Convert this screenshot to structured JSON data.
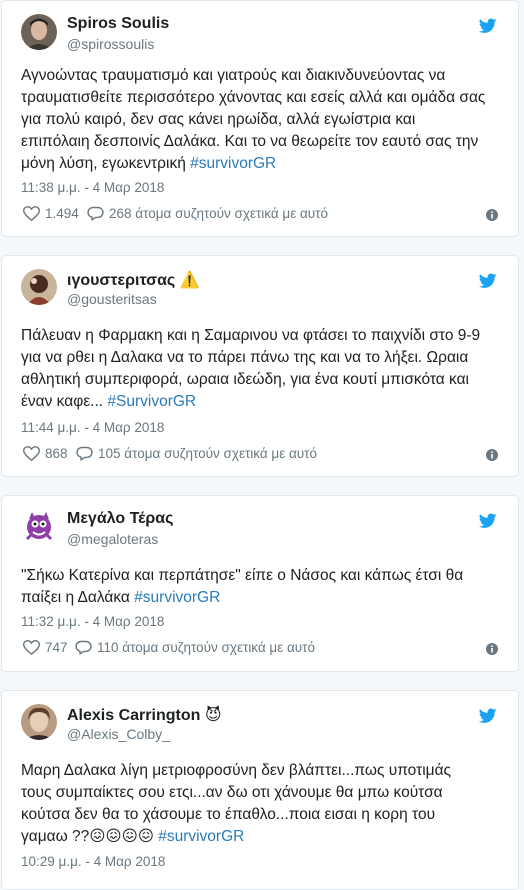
{
  "tweets": [
    {
      "name": "Spiros Soulis",
      "name_emoji": "",
      "handle": "@spirossoulis",
      "text": "Αγνοώντας τραυματισμό και γιατρούς και διακινδυνεύοντας να\nτραυματισθείτε περισσότερο χάνοντας και εσείς αλλά και ομάδα σας\nγια πολύ καιρό, δεν σας κάνει ηρωίδα, αλλά εγωίστρια και\nεπιπόλαιη δεσποινίς Δαλάκα. Και το να θεωρείτε τον εαυτό σας την\nμόνη λύση, εγωκεντρική ",
      "hashtag": "#survivorGR",
      "time": "11:38 μ.μ. - 4 Μαρ 2018",
      "likes": "1.494",
      "replies": "268 άτομα συζητούν σχετικά με αυτό"
    },
    {
      "name": "ιγουστεριτσας",
      "name_emoji": "⚠️",
      "handle": "@gousteritsas",
      "text": "Πάλευαν η Φαρμακη και η Σαμαρινου να φτάσει το παιχνίδι στο 9-9\nγια να ρθει η Δαλακα να το πάρει πάνω της και να το λήξει. Ωραια\nαθλητική συμπεριφορά, ωραια ιδεώδη, για ένα κουτί μπισκότα και\nέναν καφε... ",
      "hashtag": "#SurvivorGR",
      "time": "11:44 μ.μ. - 4 Μαρ 2018",
      "likes": "868",
      "replies": "105 άτομα συζητούν σχετικά με αυτό"
    },
    {
      "name": "Μεγάλο Τέρας",
      "name_emoji": "",
      "handle": "@megaloteras",
      "text": "\"Σήκω Κατερίνα και περπάτησε\" είπε ο Νάσος και κάπως έτσι θα\nπαίξει η Δαλάκα ",
      "hashtag": "#survivorGR",
      "time": "11:32 μ.μ. - 4 Μαρ 2018",
      "likes": "747",
      "replies": "110 άτομα συζητούν σχετικά με αυτό"
    },
    {
      "name": "Alexis Carrington",
      "name_emoji": "😈",
      "handle": "@Alexis_Colby_",
      "text": "Μαρη Δαλακα λίγη μετριοφροσύνη δεν βλάπτει...πως υποτιμάς\nτους συμπαίκτες σου ετςι...αν δω οτι χάνουμε θα μπω κούτσα\nκούτσα δεν θα το χάσουμε το έπαθλο...ποια εισαι η κορη του\nγαμαω ??😖😖😖😖 ",
      "hashtag": "#survivorGR",
      "time": "10:29 μ.μ. - 4 Μαρ 2018",
      "likes": "",
      "replies": ""
    }
  ],
  "colors": {
    "link": "#2b7bb9",
    "twitter_blue": "#1da1f2",
    "meta": "#697882"
  },
  "icons": [
    "twitter-bird-icon",
    "heart-icon",
    "reply-bubble-icon",
    "info-icon"
  ]
}
